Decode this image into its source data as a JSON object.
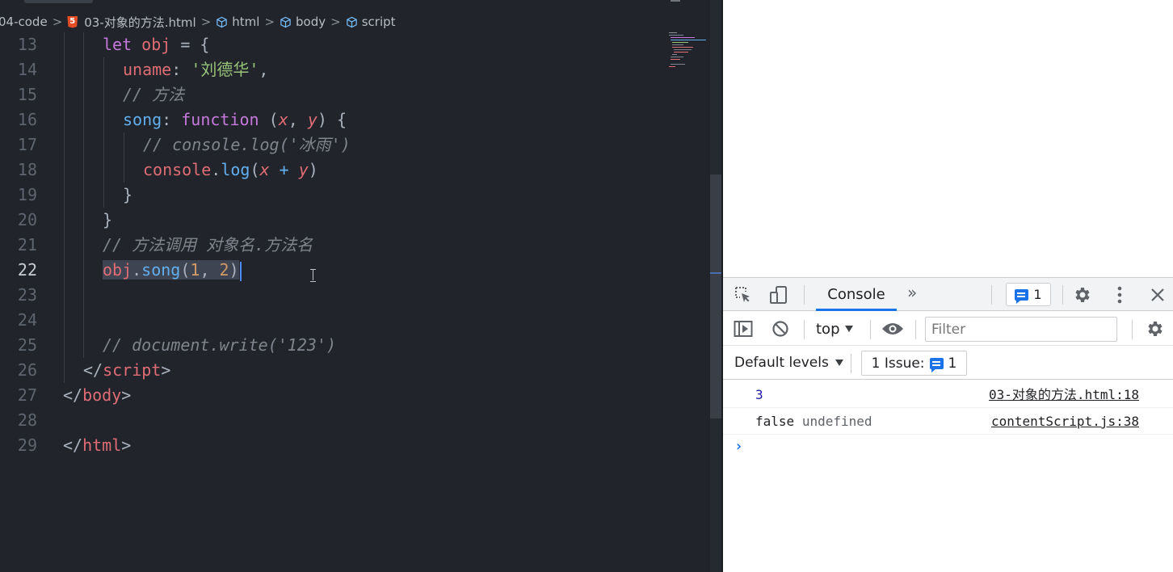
{
  "breadcrumb": {
    "folder": "04-code",
    "file": "03-对象的方法.html",
    "html": "html",
    "body": "body",
    "script": "script",
    "sep": ">"
  },
  "editor": {
    "line_numbers": [
      "13",
      "14",
      "15",
      "16",
      "17",
      "18",
      "19",
      "20",
      "21",
      "22",
      "23",
      "24",
      "25",
      "26",
      "27",
      "28",
      "29"
    ],
    "active_line": "22",
    "l13": {
      "kw": "let",
      "name": "obj",
      "rest": " = {"
    },
    "l14": {
      "prop": "uname",
      "colon": ": ",
      "str": "'刘德华'",
      "comma": ","
    },
    "l15": {
      "comment": "// 方法"
    },
    "l16": {
      "prop": "song",
      "colon": ": ",
      "kw": "function",
      "open": " (",
      "p1": "x",
      "comma": ", ",
      "p2": "y",
      "close": ") {"
    },
    "l17": {
      "comment": "// console.log('冰雨')"
    },
    "l18": {
      "obj": "console",
      "dot": ".",
      "fn": "log",
      "open": "(",
      "p1": "x",
      "plus": " + ",
      "p2": "y",
      "close": ")"
    },
    "l19": {
      "text": "}"
    },
    "l20": {
      "text": "}"
    },
    "l21": {
      "comment": "// 方法调用 对象名.方法名"
    },
    "l22": {
      "obj": "obj",
      "dot": ".",
      "fn": "song",
      "open": "(",
      "n1": "1",
      "comma": ", ",
      "n2": "2",
      "close": ")"
    },
    "l25": {
      "comment": "// document.write('123')"
    },
    "l26": {
      "open": "</",
      "tag": "script",
      "close": ">"
    },
    "l27": {
      "open": "</",
      "tag": "body",
      "close": ">"
    },
    "l29": {
      "open": "</",
      "tag": "html",
      "close": ">"
    }
  },
  "devtools": {
    "tab_console": "Console",
    "more_tabs": "»",
    "issues_count": "1",
    "context": "top",
    "filter_placeholder": "Filter",
    "levels": "Default levels",
    "issues_label": "1 Issue:",
    "issues_btn_count": "1",
    "messages": [
      {
        "value": "3",
        "source": "03-对象的方法.html:18"
      },
      {
        "value": "false",
        "value2": "undefined",
        "source": "contentScript.js:38"
      }
    ],
    "prompt": "›"
  },
  "colors": {
    "editor_bg": "#21252b",
    "keyword": "#c678dd",
    "variable": "#e06c75",
    "string": "#98c379",
    "function": "#61afef",
    "number": "#d19a66",
    "comment": "#7f848e",
    "devtools_accent": "#1a73e8"
  }
}
